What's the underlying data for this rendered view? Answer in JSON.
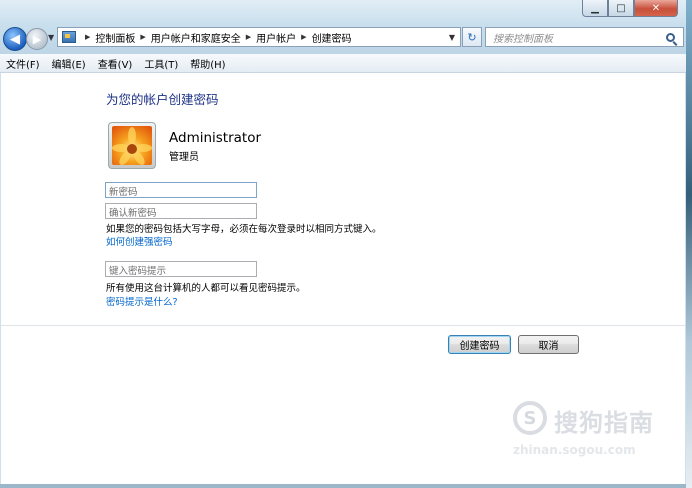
{
  "window": {
    "caption_buttons": {
      "minimize_glyph": "▁",
      "maximize_glyph": "□",
      "close_glyph": "✕"
    }
  },
  "nav": {
    "back_glyph": "◀",
    "forward_glyph": "▶",
    "breadcrumb": [
      "控制面板",
      "用户帐户和家庭安全",
      "用户帐户",
      "创建密码"
    ],
    "refresh_glyph": "↻",
    "search_placeholder": "搜索控制面板"
  },
  "menu": [
    "文件(F)",
    "编辑(E)",
    "查看(V)",
    "工具(T)",
    "帮助(H)"
  ],
  "page": {
    "title": "为您的帐户创建密码",
    "user_name": "Administrator",
    "user_role": "管理员",
    "new_password_placeholder": "新密码",
    "confirm_password_placeholder": "确认新密码",
    "case_note": "如果您的密码包括大写字母，必须在每次登录时以相同方式键入。",
    "strong_password_link": "如何创建强密码",
    "hint_placeholder": "键入密码提示",
    "hint_note": "所有使用这台计算机的人都可以看见密码提示。",
    "hint_link": "密码提示是什么?",
    "create_button": "创建密码",
    "cancel_button": "取消"
  },
  "watermark": {
    "brand": "搜狗指南",
    "logo_glyph": "S",
    "url": "zhinan.sogou.com"
  },
  "colors": {
    "title": "#1e3287",
    "link": "#0066cc",
    "close_button": "#c8503b"
  }
}
